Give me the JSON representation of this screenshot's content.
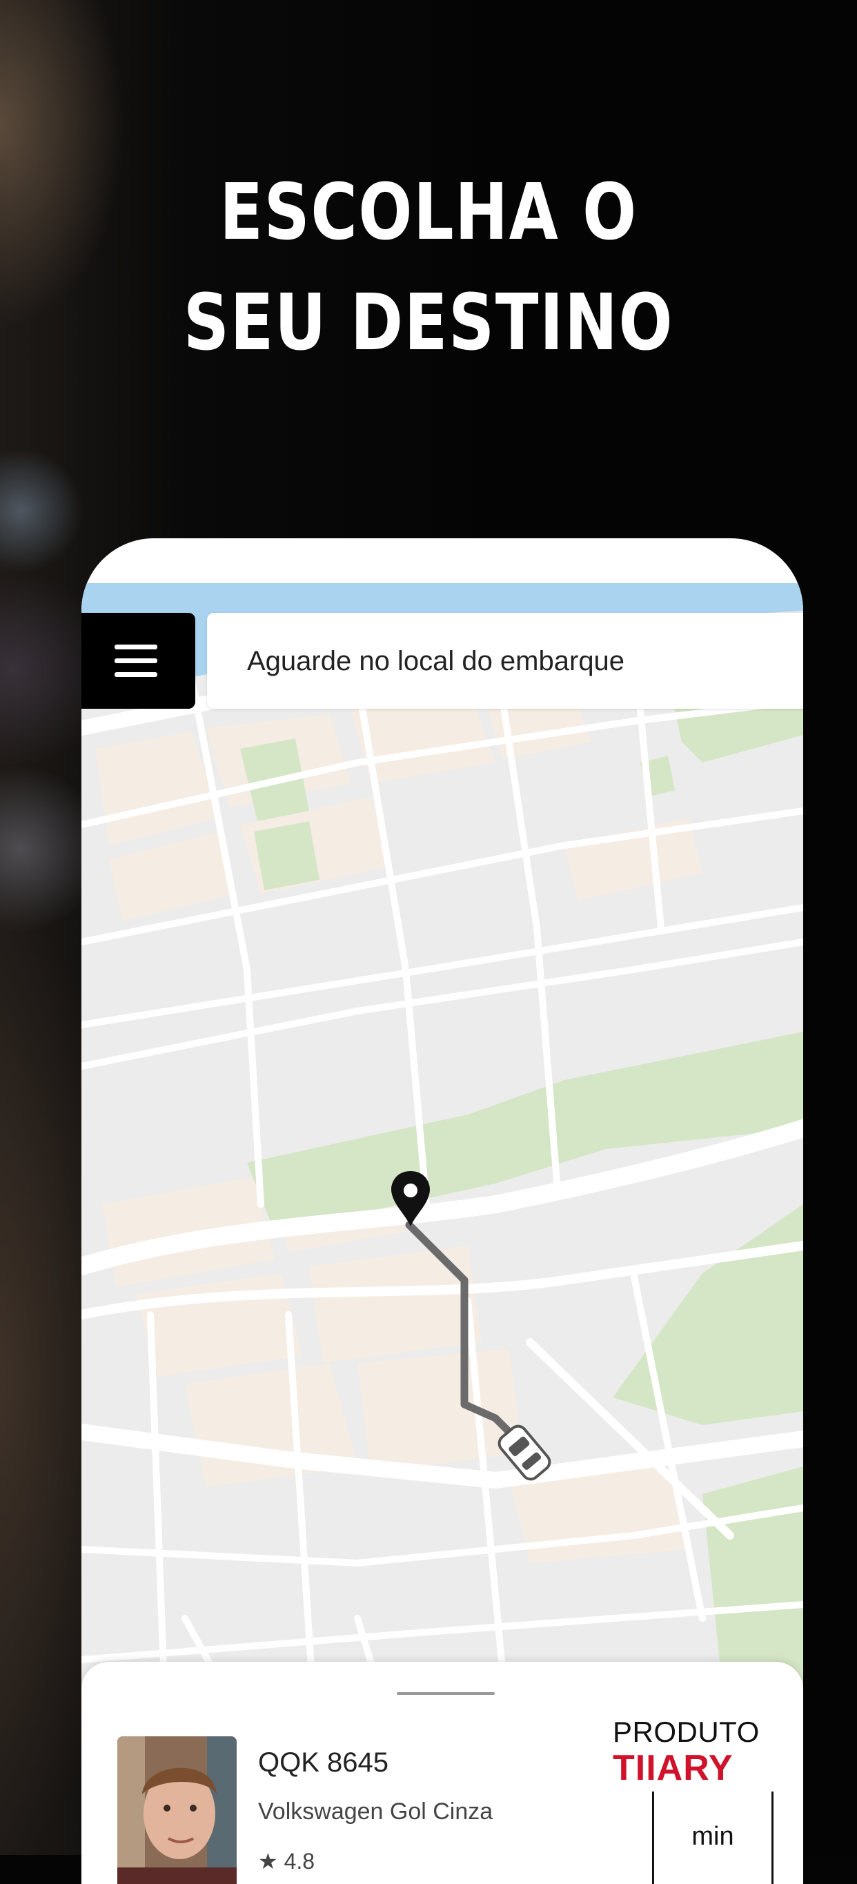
{
  "headline": {
    "line1": "ESCOLHA O",
    "line2": "SEU DESTINO"
  },
  "status_bar": {
    "message": "Aguarde no local do embarque"
  },
  "menu": {
    "icon": "hamburger-menu-icon"
  },
  "map": {
    "pin_icon": "location-pin-icon",
    "car_icon": "car-icon"
  },
  "driver": {
    "plate": "QQK 8645",
    "vehicle": "Volkswagen Gol Cinza",
    "rating_star": "★",
    "rating": "4.8"
  },
  "brand": {
    "label": "PRODUTO",
    "logo_text": "TIIARY",
    "logo_color": "#d0122b"
  },
  "eta": {
    "unit": "min"
  },
  "colors": {
    "water": "#aad3ef",
    "block": "#f5ece4",
    "park": "#d5e6c6",
    "road": "#ffffff",
    "route": "#6b6b6b"
  }
}
